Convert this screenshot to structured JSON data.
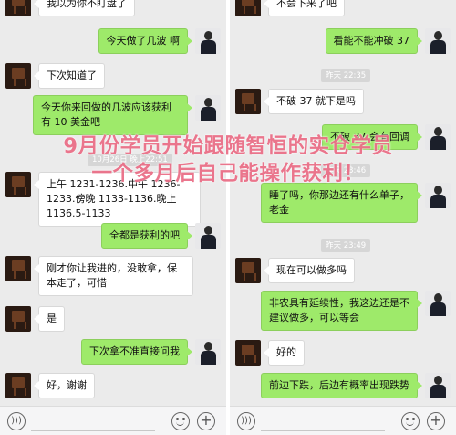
{
  "left": {
    "messages": [
      {
        "side": "left",
        "text": "我以为你不盯盘了"
      },
      {
        "side": "right",
        "text": "今天做了几波 啊"
      },
      {
        "side": "left",
        "text": "下次知道了"
      },
      {
        "side": "right",
        "text": "今天你来回做的几波应该获利有 10 美金吧"
      },
      {
        "side": "left",
        "text": "上午 1231-1236.中午 1236-1233.傍晚 1133-1136.晚上 1136.5-1133"
      },
      {
        "side": "right",
        "text": "全都是获利的吧"
      },
      {
        "side": "left",
        "text": "刚才你让我进的，没敢拿，保本走了，可惜"
      },
      {
        "side": "left",
        "text": "是"
      },
      {
        "side": "right",
        "text": "下次拿不准直接问我"
      },
      {
        "side": "left",
        "text": "好，谢谢"
      }
    ],
    "timestamp": "10月26日 晚上22:51"
  },
  "right": {
    "messages": [
      {
        "side": "left",
        "text": "不会下来了吧"
      },
      {
        "side": "right",
        "text": "看能不能冲破 37"
      },
      {
        "side": "left",
        "text": "不破 37 就下是吗"
      },
      {
        "side": "right",
        "text": "不破 37 会有回调"
      },
      {
        "side": "right",
        "text": "睡了吗，你那边还有什么单子，老金"
      },
      {
        "side": "left",
        "text": "现在可以做多吗"
      },
      {
        "side": "right",
        "text": "非农具有延续性，我这边还是不建议做多，可以等会"
      },
      {
        "side": "left",
        "text": "好的"
      },
      {
        "side": "right",
        "text": "前边下跌，后边有概率出现跌势"
      }
    ],
    "timestamps": [
      "昨天 22:35",
      "昨天 23:46",
      "昨天 23:49"
    ]
  },
  "overlay": {
    "line1": "9月份学员开始跟随智恒的实仓学员",
    "line2": "一个多月后自己能操作获利！"
  },
  "colors": {
    "chat_background": "#ebebeb",
    "sent_bubble": "#9eea6a",
    "received_bubble": "#ffffff",
    "overlay_text": "#ea6f87"
  },
  "icons": [
    "voice-icon",
    "emoji-icon",
    "plus-icon"
  ]
}
